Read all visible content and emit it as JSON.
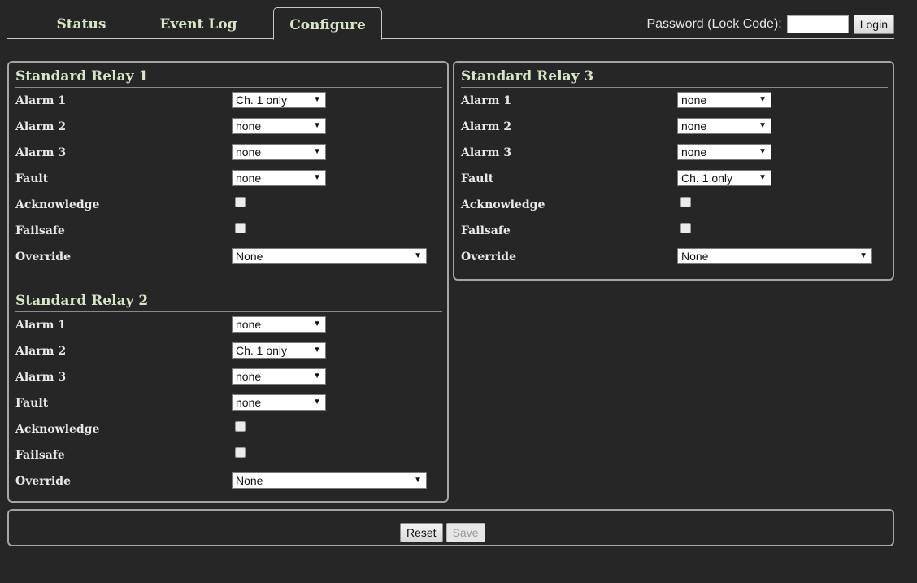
{
  "tabs": [
    {
      "label": "Status"
    },
    {
      "label": "Event Log"
    },
    {
      "label": "Configure",
      "active": true
    }
  ],
  "login": {
    "label": "Password (Lock Code):",
    "value": "",
    "button": "Login"
  },
  "relays": [
    {
      "title": "Standard Relay 1",
      "alarm1_label": "Alarm 1",
      "alarm1": "Ch. 1 only",
      "alarm2_label": "Alarm 2",
      "alarm2": "none",
      "alarm3_label": "Alarm 3",
      "alarm3": "none",
      "fault_label": "Fault",
      "fault": "none",
      "acknowledge_label": "Acknowledge",
      "acknowledge": false,
      "failsafe_label": "Failsafe",
      "failsafe": false,
      "override_label": "Override",
      "override": "None"
    },
    {
      "title": "Standard Relay 2",
      "alarm1_label": "Alarm 1",
      "alarm1": "none",
      "alarm2_label": "Alarm 2",
      "alarm2": "Ch. 1 only",
      "alarm3_label": "Alarm 3",
      "alarm3": "none",
      "fault_label": "Fault",
      "fault": "none",
      "acknowledge_label": "Acknowledge",
      "acknowledge": false,
      "failsafe_label": "Failsafe",
      "failsafe": false,
      "override_label": "Override",
      "override": "None"
    },
    {
      "title": "Standard Relay 3",
      "alarm1_label": "Alarm 1",
      "alarm1": "none",
      "alarm2_label": "Alarm 2",
      "alarm2": "none",
      "alarm3_label": "Alarm 3",
      "alarm3": "none",
      "fault_label": "Fault",
      "fault": "Ch. 1 only",
      "acknowledge_label": "Acknowledge",
      "acknowledge": false,
      "failsafe_label": "Failsafe",
      "failsafe": false,
      "override_label": "Override",
      "override": "None"
    }
  ],
  "footer": {
    "reset": "Reset",
    "save": "Save"
  },
  "colors": {
    "background": "#262626",
    "heading": "#d6e4c7",
    "border": "#a4a4a4"
  },
  "icons": {
    "dropdown": "triangle-down-icon"
  }
}
